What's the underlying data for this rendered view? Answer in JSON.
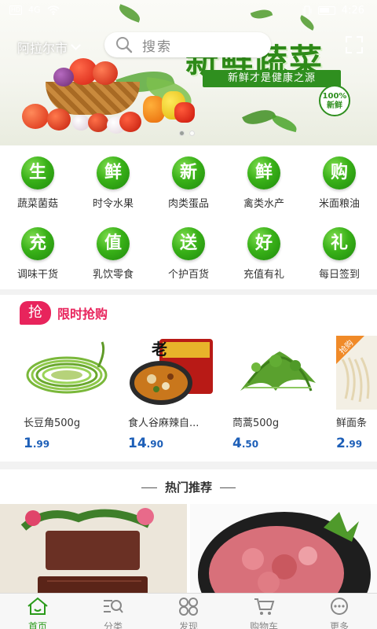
{
  "status_bar": {
    "carrier_left": "HD",
    "network": "4G",
    "time": "4:26"
  },
  "header": {
    "city": "阿拉尔市",
    "search_placeholder": "搜索"
  },
  "banner": {
    "title": "新鲜蔬菜",
    "tagline": "新鲜才是健康之源",
    "badge": "100%新鲜",
    "slides": 2,
    "active_slide": 0
  },
  "categories": [
    {
      "char": "生",
      "label": "蔬菜菌菇"
    },
    {
      "char": "鲜",
      "label": "时令水果"
    },
    {
      "char": "新",
      "label": "肉类蛋品"
    },
    {
      "char": "鲜",
      "label": "禽类水产"
    },
    {
      "char": "购",
      "label": "米面粮油"
    },
    {
      "char": "充",
      "label": "调味干货"
    },
    {
      "char": "值",
      "label": "乳饮零食"
    },
    {
      "char": "送",
      "label": "个护百货"
    },
    {
      "char": "好",
      "label": "充值有礼"
    },
    {
      "char": "礼",
      "label": "每日签到"
    }
  ],
  "flash_sale": {
    "tag": "抢",
    "title": "限时抢购",
    "corner_tag": "抢购",
    "products": [
      {
        "name": "长豆角500g",
        "price_int": "1",
        "price_dec": ".99"
      },
      {
        "name": "食人谷麻辣自...",
        "price_int": "14",
        "price_dec": ".90"
      },
      {
        "name": "茼蒿500g",
        "price_int": "4",
        "price_dec": ".50"
      },
      {
        "name": "鲜面条",
        "price_int": "2",
        "price_dec": ".99"
      }
    ]
  },
  "hot": {
    "title": "热门推荐"
  },
  "tabbar": {
    "items": [
      {
        "label": "首页",
        "icon": "home-icon",
        "active": true
      },
      {
        "label": "分类",
        "icon": "category-search-icon",
        "active": false
      },
      {
        "label": "发现",
        "icon": "discover-grid-icon",
        "active": false
      },
      {
        "label": "购物车",
        "icon": "cart-icon",
        "active": false
      },
      {
        "label": "更多",
        "icon": "more-icon",
        "active": false
      }
    ]
  },
  "colors": {
    "accent_green": "#2a9a1a",
    "flash_pink": "#e8245c",
    "price_blue": "#1d5fb8",
    "corner_orange": "#f08a28"
  }
}
